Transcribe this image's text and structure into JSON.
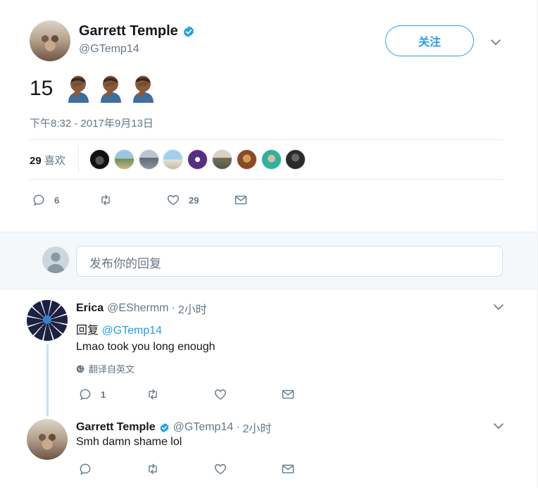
{
  "tweet": {
    "author_name": "Garrett Temple",
    "author_handle": "@GTemp14",
    "follow_label": "关注",
    "text": "15",
    "emoji_icons": [
      "facepalm-icon",
      "facepalm-icon",
      "facepalm-icon"
    ],
    "timestamp": "下午8:32 - 2017年9月13日",
    "likes_count": "29",
    "likes_label": "喜欢",
    "liker_avatar_count": 9,
    "reply_count": "6",
    "retweet_count": "",
    "like_count": "29"
  },
  "composer": {
    "placeholder": "发布你的回复"
  },
  "replies": [
    {
      "name": "Erica",
      "handle": "@EShermm",
      "separator": "·",
      "time": "2小时",
      "reply_prefix": "回复",
      "reply_to": "@GTemp14",
      "text": "Lmao took you long enough",
      "translate_label": "翻译自英文",
      "reply_count": "1"
    },
    {
      "name": "Garrett Temple",
      "handle": "@GTemp14",
      "separator": "·",
      "time": "2小时",
      "text": "Smh damn shame lol"
    }
  ],
  "colors": {
    "accent": "#1da1f2",
    "text_primary": "#14171a",
    "text_secondary": "#657786",
    "border": "#e6ecf0",
    "composer_bg": "#f5f8fa"
  }
}
